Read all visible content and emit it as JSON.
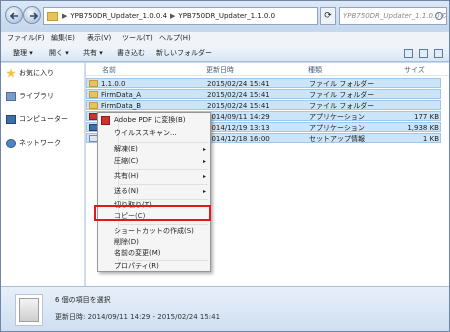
{
  "address": {
    "crumbs": [
      "YPB750DR_Updater_1.0.0.4",
      "YPB750DR_Updater_1.1.0.0"
    ],
    "separator": "▶",
    "search_placeholder": "YPB750DR_Updater_1.1.0.0の検索"
  },
  "menubar": [
    "ファイル(F)",
    "編集(E)",
    "表示(V)",
    "ツール(T)",
    "ヘルプ(H)"
  ],
  "toolbar": {
    "organize": "整理 ▾",
    "open": "開く ▾",
    "share": "共有 ▾",
    "burn": "書き込む",
    "new_folder": "新しいフォルダー"
  },
  "sidebar": {
    "favorites": "お気に入り",
    "libraries": "ライブラリ",
    "computer": "コンピューター",
    "network": "ネットワーク"
  },
  "columns": {
    "name": "名前",
    "date": "更新日時",
    "type": "種類",
    "size": "サイズ"
  },
  "files": [
    {
      "name": "1.1.0.0",
      "date": "2015/02/24 15:41",
      "type": "ファイル フォルダー",
      "size": "",
      "icon": "folder-icon"
    },
    {
      "name": "FirmData_A",
      "date": "2015/02/24 15:41",
      "type": "ファイル フォルダー",
      "size": "",
      "icon": "folder-icon"
    },
    {
      "name": "FirmData_B",
      "date": "2015/02/24 15:41",
      "type": "ファイル フォルダー",
      "size": "",
      "icon": "folder-icon"
    },
    {
      "name": "",
      "date": "2014/09/11 14:29",
      "type": "アプリケーション",
      "size": "177 KB",
      "icon": "application-icon"
    },
    {
      "name": "",
      "date": "2014/12/19 13:13",
      "type": "アプリケーション",
      "size": "1,938 KB",
      "icon": "application-icon"
    },
    {
      "name": "",
      "date": "2014/12/18 16:00",
      "type": "セットアップ情報",
      "size": "1 KB",
      "icon": "setup-info-icon"
    }
  ],
  "context_menu": {
    "pdf": "Adobe PDF に変換(B)",
    "virus": "ウイルススキャン...",
    "extract": "解凍(E)",
    "compress": "圧縮(C)",
    "share": "共有(H)",
    "send": "送る(N)",
    "cut": "切り取り(T)",
    "copy": "コピー(C)",
    "shortcut": "ショートカットの作成(S)",
    "delete": "削除(D)",
    "rename": "名前の変更(M)",
    "properties": "プロパティ(R)",
    "submenu_arrow": "▸"
  },
  "status": {
    "selected": "6 個の項目を選択",
    "modified": "更新日時: 2014/09/11 14:29 - 2015/02/24 15:41"
  },
  "colors": {
    "highlight": "#e01919",
    "selection": "#cce4f7",
    "folder": "#e8c165"
  }
}
